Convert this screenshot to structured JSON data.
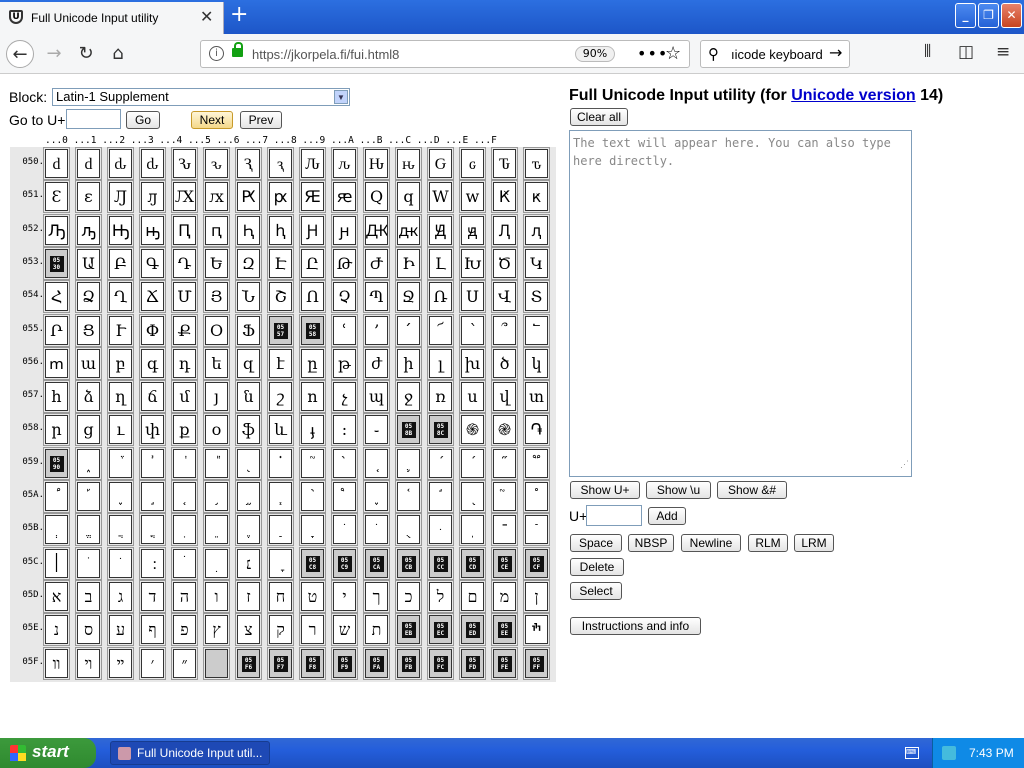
{
  "browser": {
    "tab_title": "Full Unicode Input utility",
    "url": "https://jkorpela.fi/fui.html8",
    "zoom": "90%",
    "search_text": "ıicode keyboard"
  },
  "controls": {
    "block_label": "Block:",
    "block_value": "Latin-1 Supplement",
    "goto_label": "Go to U+",
    "go_label": "Go",
    "next_label": "Next",
    "prev_label": "Prev"
  },
  "grid": {
    "column_header": "...0 ...1 ...2 ...3 ...4 ...5 ...6 ...7 ...8 ...9 ...A ...B ...C ...D ...E ...F",
    "row_labels": [
      "050.",
      "051.",
      "052.",
      "053.",
      "054.",
      "055.",
      "056.",
      "057.",
      "058.",
      "059.",
      "05A.",
      "05B.",
      "05C.",
      "05D.",
      "05E.",
      "05F."
    ],
    "rows": [
      [
        "ԁ",
        "ԁ",
        "ԃ",
        "ԃ",
        "Ԅ",
        "ԅ",
        "Ԇ",
        "ԇ",
        "Ԉ",
        "ԉ",
        "Ԋ",
        "ԋ",
        "Ԍ",
        "ԍ",
        "Ԏ",
        "ԏ"
      ],
      [
        "Ԑ",
        "ԑ",
        "Ԓ",
        "ԓ",
        "Ԕ",
        "ԕ",
        "Ԗ",
        "ԗ",
        "Ԙ",
        "ԙ",
        "Ԛ",
        "ԛ",
        "Ԝ",
        "ԝ",
        "Ԟ",
        "ԟ"
      ],
      [
        "Ԡ",
        "ԡ",
        "Ԣ",
        "ԣ",
        "Ԥ",
        "ԥ",
        "Ԧ",
        "ԧ",
        "Ԩ",
        "ԩ",
        "Ԫ",
        "ԫ",
        "Ԭ",
        "ԭ",
        "Ԯ",
        "ԯ"
      ],
      [
        "#0530",
        "Ա",
        "Բ",
        "Գ",
        "Դ",
        "Ե",
        "Զ",
        "Է",
        "Ը",
        "Թ",
        "Ժ",
        "Ի",
        "Լ",
        "Խ",
        "Ծ",
        "Կ"
      ],
      [
        "Հ",
        "Ձ",
        "Ղ",
        "Ճ",
        "Մ",
        "Յ",
        "Ն",
        "Շ",
        "Ո",
        "Չ",
        "Պ",
        "Ջ",
        "Ռ",
        "Ս",
        "Վ",
        "Տ"
      ],
      [
        "Ր",
        "Ց",
        "Ւ",
        "Փ",
        "Ք",
        "Օ",
        "Ֆ",
        "#0557",
        "#0558",
        "ՙ",
        "՚",
        "՛",
        "՜",
        "՝",
        "՞",
        "՟"
      ],
      [
        "ՠ",
        "ա",
        "բ",
        "գ",
        "դ",
        "ե",
        "զ",
        "է",
        "ը",
        "թ",
        "ժ",
        "ի",
        "լ",
        "խ",
        "ծ",
        "կ"
      ],
      [
        "հ",
        "ձ",
        "ղ",
        "ճ",
        "մ",
        "յ",
        "ն",
        "շ",
        "ո",
        "չ",
        "պ",
        "ջ",
        "ռ",
        "ս",
        "վ",
        "տ"
      ],
      [
        "ր",
        "ց",
        "ւ",
        "փ",
        "ք",
        "օ",
        "ֆ",
        "և",
        "ֈ",
        "։",
        "֊",
        "#058B",
        "#058C",
        "֍",
        "֎",
        "֏"
      ],
      [
        "#0590",
        "֑",
        "֒",
        "֓",
        "֔",
        "֕",
        "֖",
        "֗",
        "֘",
        "֙",
        "֚",
        "֛",
        "֜",
        "֝",
        "֞",
        "֟"
      ],
      [
        "֠",
        "֡",
        "֢",
        "֣",
        "֤",
        "֥",
        "֦",
        "֧",
        "֨",
        "֩",
        "֪",
        "֫",
        "֬",
        "֭",
        "֮",
        "֯"
      ],
      [
        "ְ",
        "ֱ",
        "ֲ",
        "ֳ",
        "ִ",
        "ֵ",
        "ֶ",
        "ַ",
        "ָ",
        "ֹ",
        "ֺ",
        "ֻ",
        "ּ",
        "ֽ",
        "־",
        "ֿ"
      ],
      [
        "׀",
        "ׁ",
        "ׂ",
        "׃",
        "ׄ",
        "ׅ",
        "׆",
        "ׇ",
        "#05C8",
        "#05C9",
        "#05CA",
        "#05CB",
        "#05CC",
        "#05CD",
        "#05CE",
        "#05CF"
      ],
      [
        "א",
        "ב",
        "ג",
        "ד",
        "ה",
        "ו",
        "ז",
        "ח",
        "ט",
        "י",
        "ך",
        "כ",
        "ל",
        "ם",
        "מ",
        "ן"
      ],
      [
        "נ",
        "ס",
        "ע",
        "ף",
        "פ",
        "ץ",
        "צ",
        "ק",
        "ר",
        "ש",
        "ת",
        "#05EB",
        "#05EC",
        "#05ED",
        "#05EE",
        "ׯ"
      ],
      [
        "װ",
        "ױ",
        "ײ",
        "׳",
        "״",
        "#NA",
        "#05F6",
        "#05F7",
        "#05F8",
        "#05F9",
        "#05FA",
        "#05FB",
        "#05FC",
        "#05FD",
        "#05FE",
        "#05FF"
      ]
    ]
  },
  "right": {
    "title_prefix": "Full Unicode Input utility (for ",
    "title_link": "Unicode version",
    "title_suffix": " 14)",
    "clear_label": "Clear all",
    "textarea_placeholder": "The text will appear here. You can also type here directly.",
    "show_uplus": "Show U+",
    "show_u": "Show \\u",
    "show_amp": "Show &#",
    "uplus_label": "U+",
    "add_label": "Add",
    "space_label": "Space",
    "nbsp_label": "NBSP",
    "newline_label": "Newline",
    "rlm_label": "RLM",
    "lrm_label": "LRM",
    "delete_label": "Delete",
    "select_label": "Select",
    "info_label": "Instructions and info"
  },
  "taskbar": {
    "start_label": "start",
    "task_label": "Full Unicode Input util...",
    "clock": "7:43 PM"
  }
}
